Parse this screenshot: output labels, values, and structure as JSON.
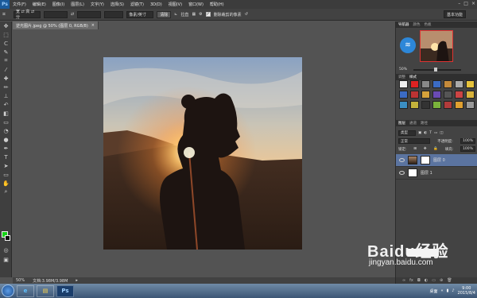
{
  "menubar": {
    "logo": "Ps",
    "items": [
      "文件(F)",
      "编辑(E)",
      "图像(I)",
      "图层(L)",
      "文字(Y)",
      "选择(S)",
      "滤镜(T)",
      "3D(D)",
      "视图(V)",
      "窗口(W)",
      "帮助(H)"
    ]
  },
  "options": {
    "mode": "宽 ⇄ 高 ⇄ 分",
    "w_label": "宽:",
    "h_label": "高:",
    "unit": "像素/英寸",
    "clear_label": "清除",
    "straighten_label": "拉直",
    "delete_cropped_label": "删除裁剪的像素",
    "workspace": "基本功能"
  },
  "doc": {
    "tab_title": "逆光图片.jpeg @ 50% (图层 0, RGB/8)",
    "close": "×"
  },
  "status": {
    "zoom": "50%",
    "doc_size": "文档:3.98M/3.98M"
  },
  "panels": {
    "nav_tabs": [
      "导航器",
      "颜色",
      "色板"
    ],
    "nav_zoom": "50%",
    "styles_tabs": [
      "调整",
      "样式"
    ],
    "layer_tabs": [
      "图层",
      "通道",
      "路径"
    ],
    "filter_label": "类型",
    "blend_mode": "正常",
    "opacity_label": "不透明度:",
    "opacity_value": "100%",
    "lock_label": "锁定:",
    "fill_label": "填充:",
    "fill_value": "100%",
    "layers": [
      {
        "name": "图层 0",
        "selected": true
      },
      {
        "name": "图层 1",
        "selected": false
      }
    ]
  },
  "watermark": {
    "logo": "Baidu经验",
    "url": "jingyan.baidu.com"
  },
  "taskbar": {
    "ps_label": "Ps",
    "desktop_label": "桌面",
    "time": "9:00",
    "date": "2015/8/4"
  },
  "colors": {
    "foreground": "#17d317",
    "background": "#111111",
    "layer_selected": "#5b74a0"
  }
}
